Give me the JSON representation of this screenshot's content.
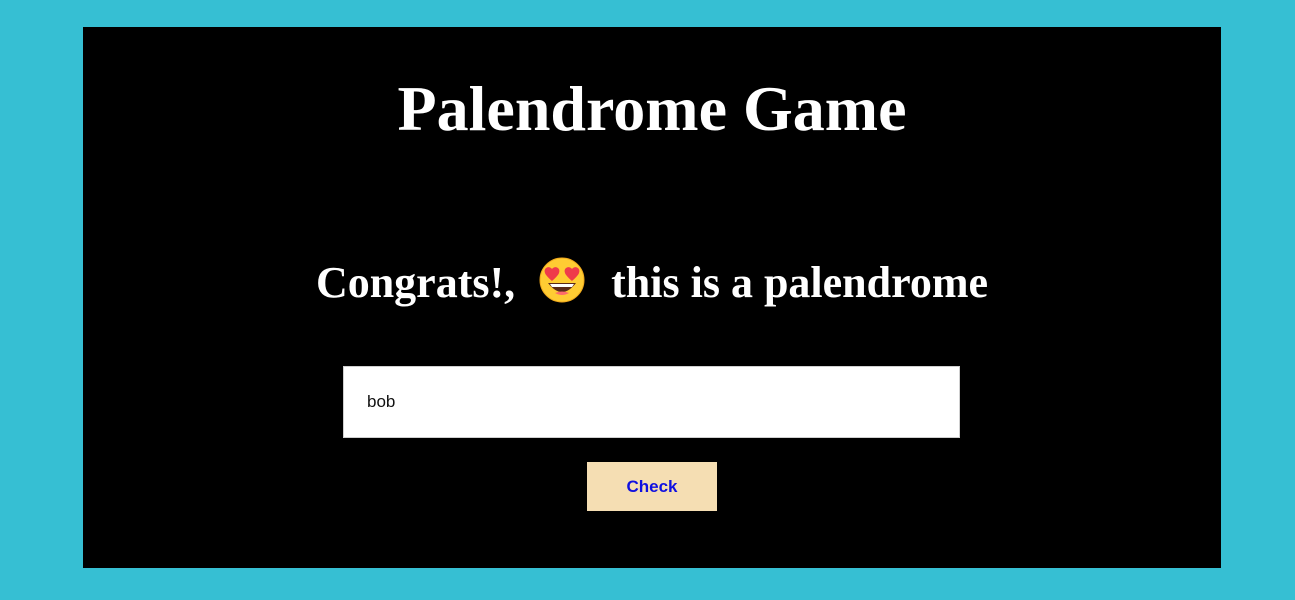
{
  "game": {
    "title": "Palendrome Game",
    "result": {
      "prefix": "Congrats!,",
      "emoji_icon": "heart-eyes-face-icon",
      "suffix": "this is a palendrome"
    },
    "input": {
      "value": "bob"
    },
    "check_label": "Check"
  },
  "colors": {
    "page_background": "#36bfd3",
    "panel_background": "#000000",
    "text": "#ffffff",
    "button_background": "#f5deb3",
    "button_text": "#1010e0"
  }
}
